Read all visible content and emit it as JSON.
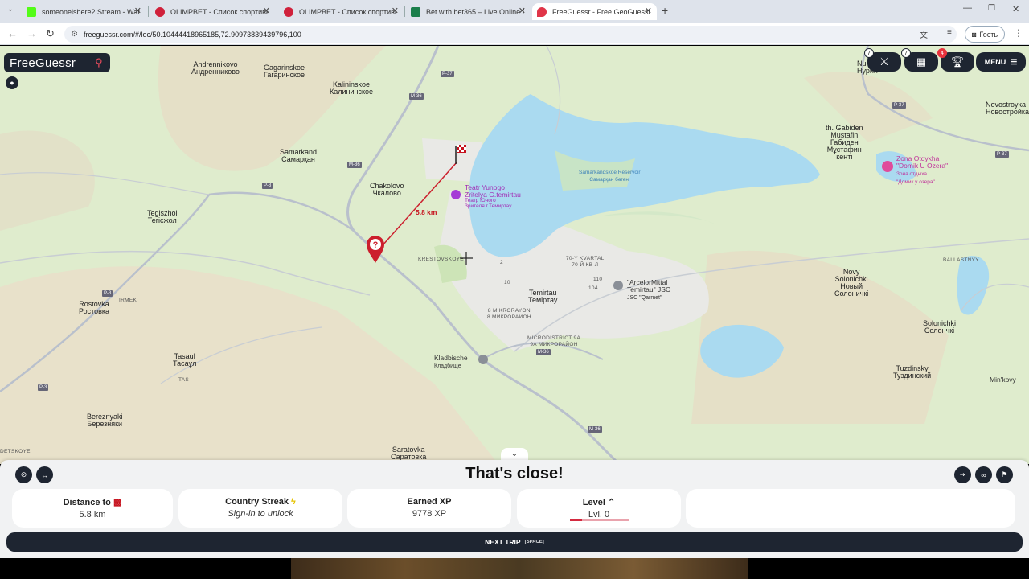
{
  "browser": {
    "tabs": [
      {
        "title": "someoneishere2 Stream - Watc",
        "fav_color": "#53fc18"
      },
      {
        "title": "OLIMPBET - Список спортивн",
        "fav_color": "#d0213b"
      },
      {
        "title": "OLIMPBET - Список спортивн",
        "fav_color": "#d0213b"
      },
      {
        "title": "Bet with bet365 – Live Online B",
        "fav_color": "#1b7f4b"
      },
      {
        "title": "FreeGuessr - Free GeoGuessr A",
        "fav_color": "#e03548"
      }
    ],
    "url": "freeguessr.com/#/loc/50.10444418965185,72.90973839439796,100",
    "guest_label": "Гость"
  },
  "app": {
    "logo": "FreeGuessr",
    "menu_label": "MENU",
    "badges": {
      "duels": "7",
      "party": "7",
      "trophy": "4"
    }
  },
  "map": {
    "distance_label": "5.8 km",
    "places": {
      "andrennikovo": "Andrennikovo",
      "andrennikovo_ru": "Андренниково",
      "gagarinskoe": "Gagarinskoe",
      "gagarinskoe_ru": "Гагаринское",
      "kalininskoe": "Kalininskoe",
      "kalininskoe_ru": "Калининское",
      "samarkand": "Samarkand",
      "samarkand_ru": "Самарқан",
      "chakolovo": "Chakolovo",
      "chakolovo_ru": "Чкалово",
      "tegiszhol": "Tegiszhol",
      "tegiszhol_ru": "Тегісжол",
      "rostovka": "Rostovka",
      "rostovka_ru": "Ростовка",
      "irmek": "IRMEK",
      "tasaul": "Tasaul",
      "tasaul_ru": "Тасаұл",
      "tas": "TAS",
      "bereznyaki": "Bereznyaki",
      "bereznyaki_ru": "Березняки",
      "saratovka": "Saratovka",
      "saratovka_ru": "Саратовка",
      "dets": "DETSKOYE",
      "teatr1": "Teatr Yunogo",
      "teatr2": "Zritelya G.temirtau",
      "teatr_ru1": "Театр Юного",
      "teatr_ru2": "Зрителя г.Темиртау",
      "krestovskoye": "KRESTOVSKOYE",
      "temirtau": "Temirtau",
      "temirtau_ru": "Теміртау",
      "mikro8": "8 MIKRORAYON",
      "mikro8_ru": "8 МИКРОРАЙОН",
      "mikro9": "MICRODISTRICT 9A",
      "mikro9_ru": "9А МИКРОРАЙОН",
      "kvartal70": "70-Y KVARTAL",
      "kvartal70_ru": "70-Й КВ-Л",
      "arcelor1": "\"ArcelorMittal",
      "arcelor2": "Temirtau\" JSC",
      "arcelor3": "JSC \"Qarmet\"",
      "kladbische": "Kladbische",
      "kladbische_ru": "Кладбище",
      "reservoir": "Samarkandskoe Reservoir",
      "reservoir_ru": "Самарқан бөгені",
      "gabiden1": "th. Gabiden",
      "gabiden2": "Mustafin",
      "gabiden3": "Габиден",
      "gabiden4": "Мұстафин",
      "gabiden5": "кенті",
      "zona1": "Zona Otdykha",
      "zona2": "\"Domik U Ozera\"",
      "zona3": "Зона отдыха",
      "zona4": "\"Домик у озера\"",
      "novostroyka": "Novostroyka",
      "novostroyka_ru": "Новостройка",
      "nura": "Nur",
      "nura_ru": "Нурин",
      "novy1": "Novy",
      "novy2": "Solonichki",
      "novy3": "Новый",
      "novy4": "Солоничкі",
      "solonichki": "Solonichki",
      "solonichki_ru": "Солончкі",
      "tuzdinsky": "Tuzdinsky",
      "tuzdinsky_ru": "Туздинский",
      "minkovy": "Min'kovy",
      "ballastny": "BALLASTNYY",
      "n2": "2",
      "n10": "10",
      "n110": "110",
      "n104": "104"
    },
    "roads": {
      "p37a": "P-37",
      "m36a": "M-36",
      "m36b": "M-36",
      "p3a": "P-3",
      "p3b": "P-3",
      "p3c": "P-3",
      "m36c": "M-36",
      "m36d": "M-36",
      "p37b": "P-37",
      "p37c": "P-37"
    }
  },
  "result": {
    "headline": "That's close!",
    "distance_title": "Distance to",
    "distance_value": "5.8 km",
    "streak_title": "Country Streak",
    "streak_value": "Sign-in to unlock",
    "xp_title": "Earned XP",
    "xp_value": "9778 XP",
    "level_title": "Level",
    "level_value": "Lvl. 0",
    "level_progress": 0.2,
    "next_label": "NEXT TRIP",
    "next_key": "[SPACE]"
  }
}
